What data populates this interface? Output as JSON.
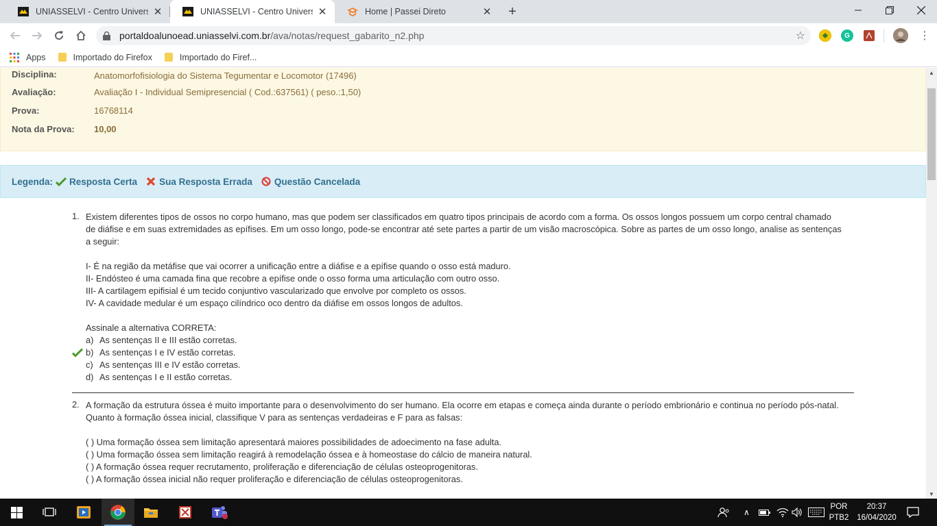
{
  "browser": {
    "tabs": [
      {
        "title": "UNIASSELVI - Centro Universitário",
        "active": false
      },
      {
        "title": "UNIASSELVI - Centro Universitário",
        "active": true
      },
      {
        "title": "Home | Passei Direto",
        "active": false
      }
    ],
    "url_domain": "portaldoalunoead.uniasselvi.com.br",
    "url_path": "/ava/notas/request_gabarito_n2.php",
    "bookmarks": [
      "Apps",
      "Importado do Firefox",
      "Importado do Firef..."
    ]
  },
  "exam_info": {
    "disciplina_label": "Disciplina:",
    "disciplina_value": "Anatomorfofisiologia do Sistema Tegumentar e Locomotor (17496)",
    "avaliacao_label": "Avaliação:",
    "avaliacao_value": "Avaliação I - Individual Semipresencial ( Cod.:637561) ( peso.:1,50)",
    "prova_label": "Prova:",
    "prova_value": "16768114",
    "nota_label": "Nota da Prova:",
    "nota_value": "10,00"
  },
  "legend": {
    "label": "Legenda:",
    "correct": "Resposta Certa",
    "wrong": "Sua Resposta Errada",
    "cancelled": "Questão Cancelada"
  },
  "q1": {
    "number": "1.",
    "lines": [
      "Existem diferentes tipos de ossos no corpo humano, mas que podem ser classificados em quatro tipos principais de acordo com a forma. Os ossos longos possuem um corpo central chamado",
      "de diáfise e em suas extremidades as epífises. Em um osso longo, pode-se encontrar até sete partes a partir de um visão macroscópica. Sobre as partes de um osso longo, analise as sentenças",
      "a seguir:"
    ],
    "sentences": [
      "I- É na região da metáfise que vai ocorrer a unificação entre a diáfise e a epífise quando o osso está maduro.",
      "II- Endósteo é uma camada fina que recobre a epífise onde o osso forma uma articulação com outro osso.",
      "III- A cartilagem epifisial é um tecido conjuntivo vascularizado que envolve por completo os ossos.",
      "IV- A cavidade medular é um espaço cilíndrico oco dentro da diáfise em ossos longos de adultos."
    ],
    "prompt": "Assinale a alternativa CORRETA:",
    "options": [
      {
        "letter": "a)",
        "text": "As sentenças II e III estão corretas."
      },
      {
        "letter": "b)",
        "text": "As sentenças I e IV estão corretas."
      },
      {
        "letter": "c)",
        "text": "As sentenças III e IV estão corretas."
      },
      {
        "letter": "d)",
        "text": "As sentenças I e II estão corretas."
      }
    ]
  },
  "q2": {
    "number": "2.",
    "lines": [
      "A formação da estrutura óssea é muito importante para o desenvolvimento do ser humano. Ela ocorre em etapas e começa ainda durante o período embrionário e continua no período pós-natal.",
      "Quanto à formação óssea inicial, classifique V para as sentenças verdadeiras e F para as falsas:"
    ],
    "sentences": [
      "(    ) Uma formação óssea sem limitação apresentará maiores possibilidades de adoecimento na fase adulta.",
      "(    ) Uma formação óssea sem limitação reagirá à remodelação óssea e à homeostase do cálcio de maneira natural.",
      "(    ) A formação óssea requer recrutamento, proliferação e diferenciação de células osteoprogenitoras.",
      "(    ) A formação óssea inicial não requer proliferação e diferenciação de células osteoprogenitoras."
    ]
  },
  "taskbar": {
    "lang1": "POR",
    "lang2": "PTB2",
    "time": "20:37",
    "date": "16/04/2020"
  }
}
